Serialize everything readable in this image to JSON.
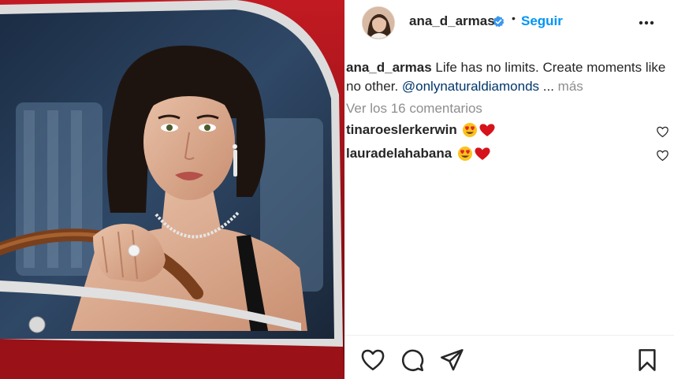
{
  "post": {
    "username": "ana_d_armas",
    "separator": "•",
    "follow_label": "Seguir",
    "caption": {
      "author": "ana_d_armas",
      "text": " Life has no limits. Create moments like no other. ",
      "mention": "@onlynaturaldiamonds",
      "ellipsis": " ... ",
      "more_label": "más"
    },
    "view_comments_label": "Ver los 16 comentarios",
    "comments": [
      {
        "user": "tinaroeslerkerwin",
        "emoji": [
          "heart-eyes-emoji",
          "red-heart-emoji"
        ]
      },
      {
        "user": "lauradelahabana",
        "emoji": [
          "heart-eyes-emoji",
          "red-heart-emoji"
        ]
      }
    ]
  },
  "icons": {
    "verified": "verified-badge-icon",
    "more": "more-options-icon",
    "like": "heart-icon",
    "comment": "comment-icon",
    "share": "paper-plane-icon",
    "save": "bookmark-icon"
  },
  "colors": {
    "link_blue": "#0095f6",
    "mention_blue": "#00376b",
    "muted_gray": "#8e8e8e",
    "text": "#262626",
    "car_red": "#b0151c"
  }
}
